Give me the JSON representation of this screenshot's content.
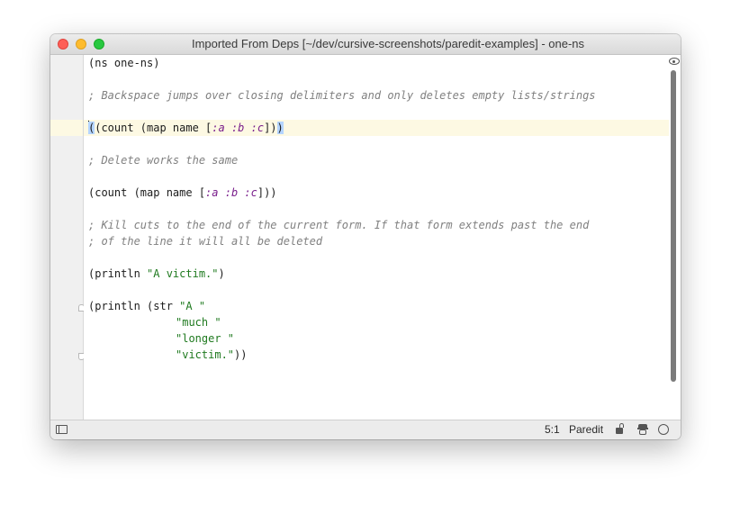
{
  "window": {
    "title": "Imported From Deps [~/dev/cursive-screenshots/paredit-examples] - one-ns"
  },
  "editor": {
    "lines": {
      "l1": "(ns one-ns)",
      "l3": "; Backspace jumps over closing delimiters and only deletes empty lists/strings",
      "l5a": "(count (map name [",
      "l5b": ":a :b :c",
      "l5c": "])",
      "l5d": ")",
      "l7": "; Delete works the same",
      "l9a": "(count (map name [",
      "l9b": ":a :b :c",
      "l9c": "]))",
      "l11": "; Kill cuts to the end of the current form. If that form extends past the end",
      "l12": "; of the line it will all be deleted",
      "l14a": "(println ",
      "l14b": "\"A victim.\"",
      "l14c": ")",
      "l16a": "(println (str ",
      "l16b": "\"A \"",
      "l17": "\"much \"",
      "l18": "\"longer \"",
      "l19a": "\"victim.\"",
      "l19b": "))"
    },
    "caret_line": 5
  },
  "statusbar": {
    "position": "5:1",
    "mode": "Paredit"
  },
  "colors": {
    "comment": "#808080",
    "keyword": "#7a1f8c",
    "string": "#1f7a1f",
    "caret_line_bg": "#fdf9e3",
    "paren_match": "#b5d5ff"
  },
  "icons": [
    "eye-icon",
    "panel-toggle-icon",
    "lock-icon",
    "inspector-icon",
    "chat-bubble-icon"
  ]
}
